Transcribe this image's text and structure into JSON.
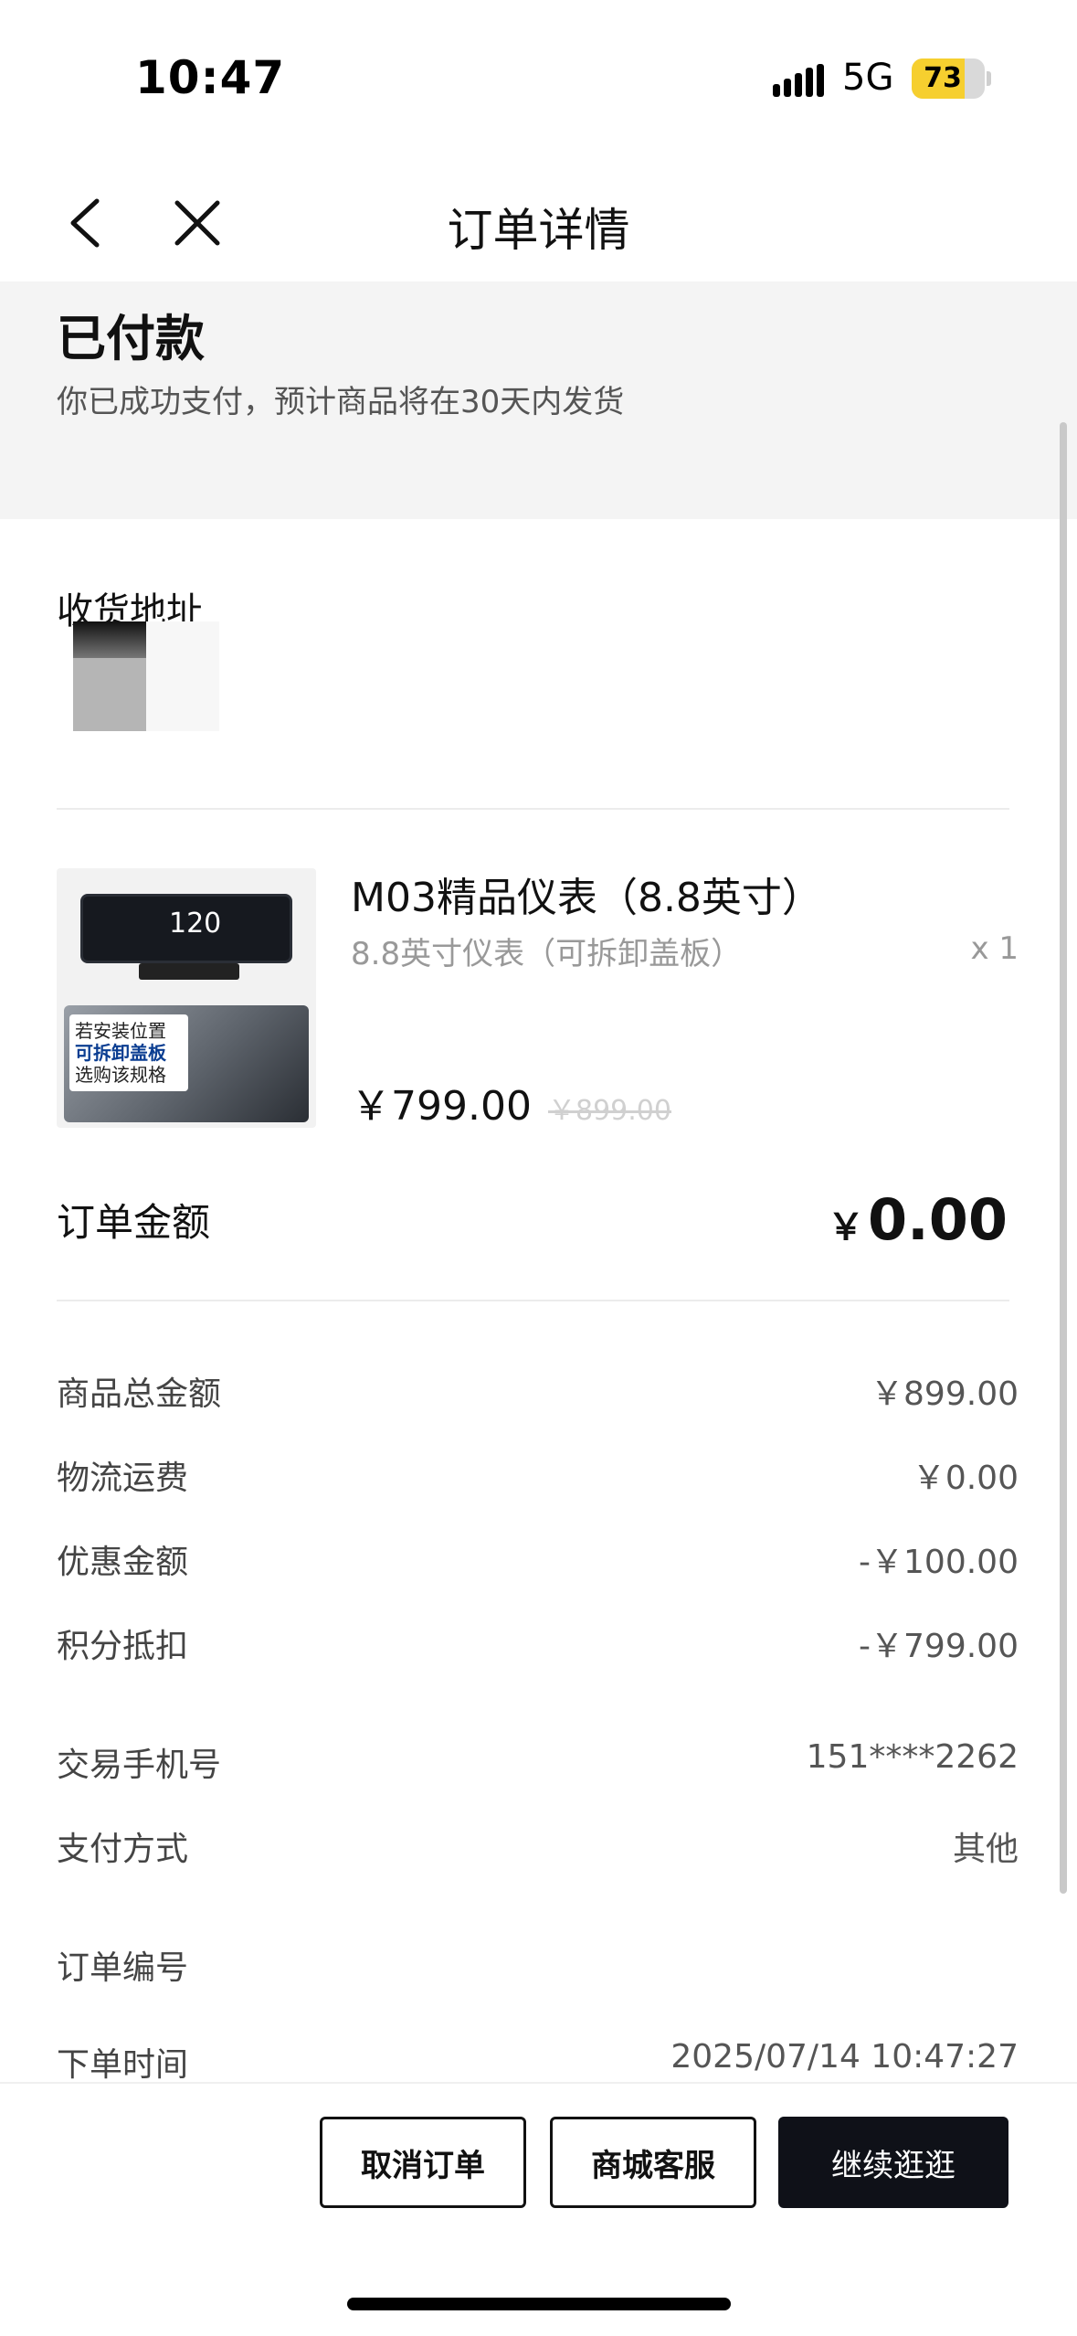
{
  "status_bar": {
    "time": "10:47",
    "network": "5G",
    "battery_level": "73",
    "battery_color": "#f6cf2f"
  },
  "nav": {
    "title": "订单详情",
    "back_icon": "chevron-left-icon",
    "close_icon": "close-icon"
  },
  "order_status": {
    "title": "已付款",
    "subtitle": "你已成功支付，预计商品将在30天内发货"
  },
  "address": {
    "label": "收货地址"
  },
  "product": {
    "name": "M03精品仪表（8.8英寸）",
    "variant": "8.8英寸仪表（可拆卸盖板）",
    "quantity": "x 1",
    "price": "￥799.00",
    "original_price": "￥899.00",
    "image": {
      "speed": "120",
      "note_line1": "若安装位置",
      "note_line2": "可拆卸盖板",
      "note_line3": "选购该规格"
    }
  },
  "order_total": {
    "label": "订单金额",
    "currency": "￥",
    "amount": "0.00"
  },
  "price_rows": [
    {
      "label": "商品总金额",
      "value": "￥899.00"
    },
    {
      "label": "物流运费",
      "value": "￥0.00"
    },
    {
      "label": "优惠金额",
      "value": "-￥100.00"
    },
    {
      "label": "积分抵扣",
      "value": "-￥799.00"
    }
  ],
  "info_rows": [
    {
      "label": "交易手机号",
      "value": "151****2262"
    },
    {
      "label": "支付方式",
      "value": "其他"
    },
    {
      "label": "订单编号",
      "value": ""
    },
    {
      "label": "下单时间",
      "value": "2025/07/14 10:47:27"
    }
  ],
  "actions": {
    "cancel": "取消订单",
    "service": "商城客服",
    "continue": "继续逛逛"
  }
}
